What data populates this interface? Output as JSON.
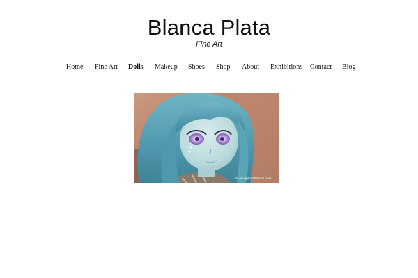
{
  "header": {
    "title": "Blanca Plata",
    "subtitle": "Fine Art"
  },
  "nav": {
    "items": [
      {
        "label": "Home"
      },
      {
        "label": "Fine Art"
      },
      {
        "label": "Dolls",
        "active": true
      },
      {
        "label": "Makeup"
      },
      {
        "label": "Shoes"
      },
      {
        "label": "Shop"
      },
      {
        "label": "About"
      },
      {
        "label": "Exhibitions"
      },
      {
        "label": "Contact"
      },
      {
        "label": "Blog"
      }
    ]
  },
  "photo": {
    "icon": "doll-portrait-image",
    "watermark": "blancaplatafineart.com"
  },
  "colors": {
    "background": "#ffffff",
    "text": "#111111",
    "hair": "#5aa4b8",
    "backdrop": "#b8826a"
  }
}
